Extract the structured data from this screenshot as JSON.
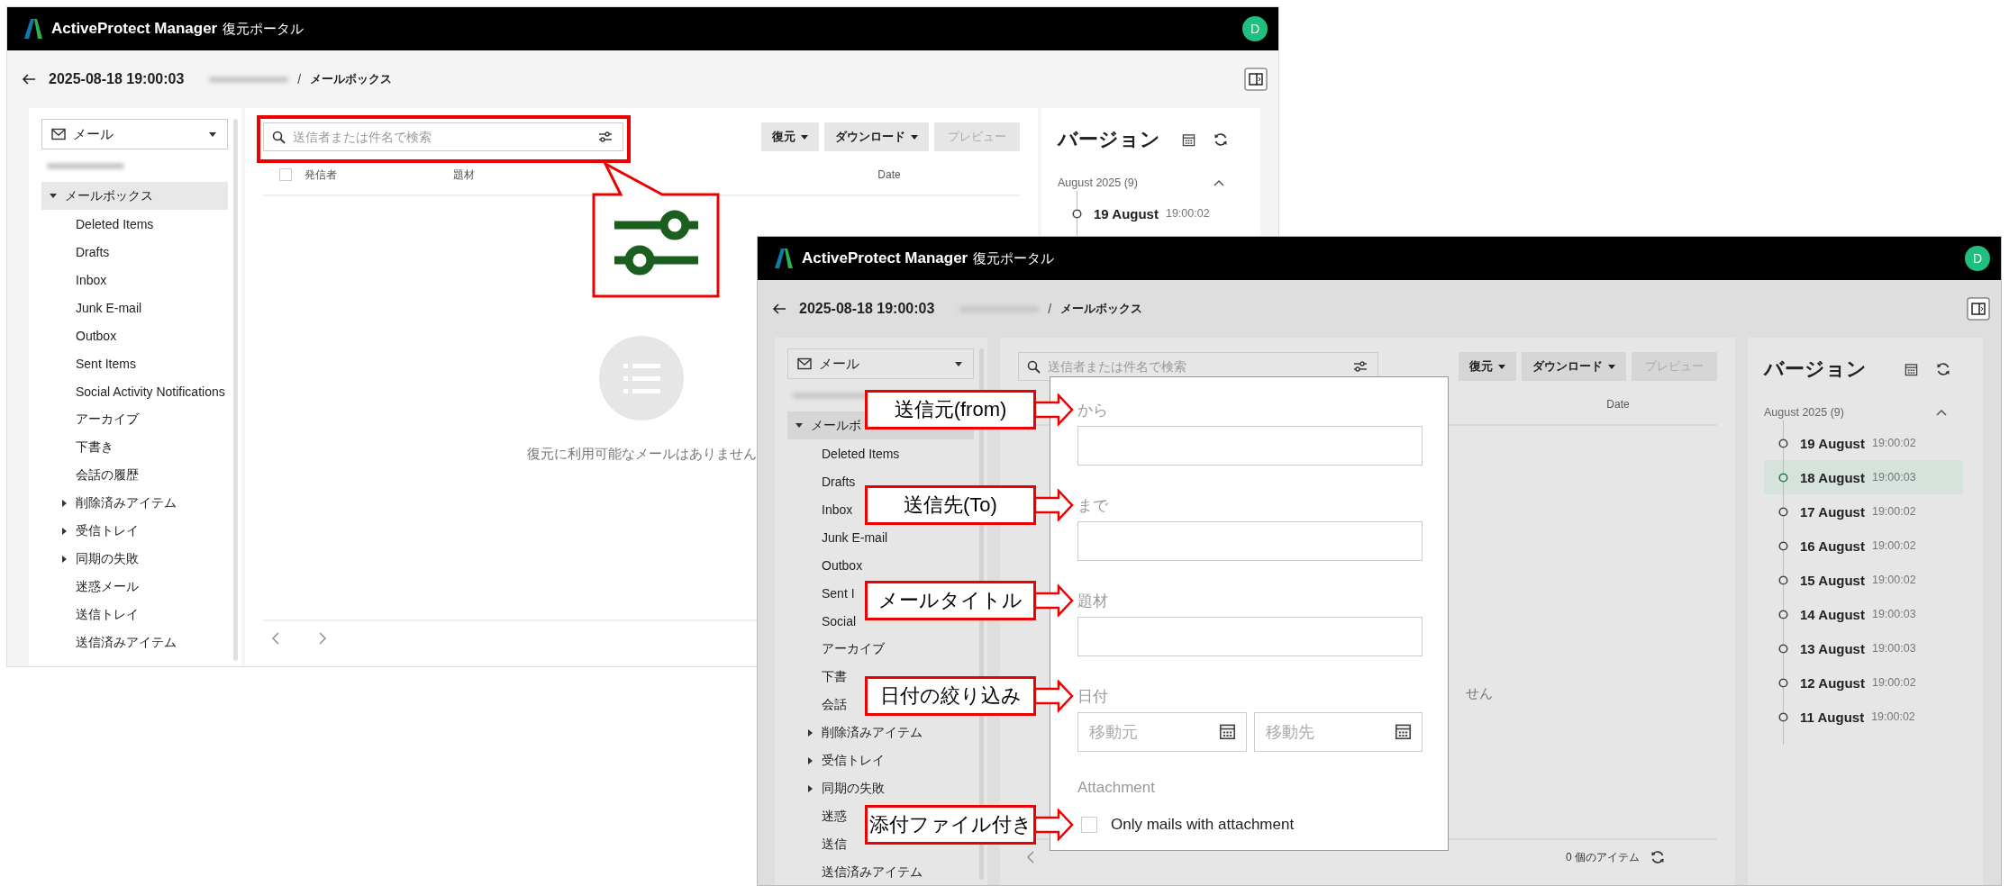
{
  "windows": [
    {
      "dimmed": false,
      "header": {
        "brand": "ActiveProtect Manager",
        "subtitle": "復元ポータル",
        "avatar": "D"
      },
      "breadcrumb": {
        "date": "2025-08-18 19:00:03",
        "separator": "/",
        "section": "メールボックス"
      },
      "sidebar": {
        "dropdown": "メール",
        "tree": [
          {
            "label": "メールボックス",
            "kind": "group",
            "expanded": true,
            "selected": true,
            "children": [
              {
                "label": "Deleted Items",
                "kind": "leaf",
                "selected": false
              },
              {
                "label": "Drafts",
                "kind": "leaf",
                "selected": false
              },
              {
                "label": "Inbox",
                "kind": "leaf",
                "selected": false
              },
              {
                "label": "Junk E-mail",
                "kind": "leaf",
                "selected": false
              },
              {
                "label": "Outbox",
                "kind": "leaf",
                "selected": false
              },
              {
                "label": "Sent Items",
                "kind": "leaf",
                "selected": false
              },
              {
                "label": "Social Activity Notifications",
                "kind": "leaf",
                "selected": false
              },
              {
                "label": "アーカイブ",
                "kind": "leaf",
                "selected": false
              },
              {
                "label": "下書き",
                "kind": "leaf",
                "selected": false
              },
              {
                "label": "会話の履歴",
                "kind": "leaf",
                "selected": false
              },
              {
                "label": "削除済みアイテム",
                "kind": "group",
                "expanded": false,
                "selected": false
              },
              {
                "label": "受信トレイ",
                "kind": "group",
                "expanded": false,
                "selected": false
              },
              {
                "label": "同期の失敗",
                "kind": "group",
                "expanded": false,
                "selected": false
              },
              {
                "label": "迷惑メール",
                "kind": "leaf",
                "selected": false
              },
              {
                "label": "送信トレイ",
                "kind": "leaf",
                "selected": false
              },
              {
                "label": "送信済みアイテム",
                "kind": "leaf",
                "selected": false
              }
            ]
          }
        ]
      },
      "search": {
        "placeholder": "送信者または件名で検索",
        "highlighted": true
      },
      "buttons": [
        {
          "label": "復元",
          "menu": true,
          "disabled": false
        },
        {
          "label": "ダウンロード",
          "menu": true,
          "disabled": false
        },
        {
          "label": "プレビュー",
          "menu": false,
          "disabled": true
        }
      ],
      "select_all": {
        "checked": false
      },
      "columns": [
        {
          "kind": "sender",
          "label": "発信者"
        },
        {
          "kind": "subject",
          "label": "題材"
        },
        {
          "kind": "date",
          "label": "Date"
        }
      ],
      "empty_state": {
        "kind": "full",
        "message": "復元に利用可能なメールはありません"
      },
      "pager": {
        "prev": true,
        "next": true
      },
      "versions": {
        "title": "バージョン",
        "group": {
          "label": "August 2025 (9)",
          "expanded": true
        },
        "items": [
          {
            "day": "19 August",
            "time": "19:00:02",
            "selected": false
          }
        ]
      }
    },
    {
      "dimmed": true,
      "header": {
        "brand": "ActiveProtect Manager",
        "subtitle": "復元ポータル",
        "avatar": "D"
      },
      "breadcrumb": {
        "date": "2025-08-18 19:00:03",
        "separator": "/",
        "section": "メールボックス"
      },
      "sidebar": {
        "dropdown": "メール",
        "tree": [
          {
            "label": "メールボ",
            "kind": "group",
            "expanded": true,
            "selected": true,
            "children": [
              {
                "label": "Deleted Items",
                "kind": "leaf",
                "selected": false
              },
              {
                "label": "Drafts",
                "kind": "leaf",
                "selected": false
              },
              {
                "label": "Inbox",
                "kind": "leaf",
                "selected": false
              },
              {
                "label": "Junk E-mail",
                "kind": "leaf",
                "selected": false
              },
              {
                "label": "Outbox",
                "kind": "leaf",
                "selected": false
              },
              {
                "label": "Sent I",
                "kind": "leaf",
                "selected": false
              },
              {
                "label": "Social",
                "kind": "leaf",
                "selected": false
              },
              {
                "label": "アーカイブ",
                "kind": "leaf",
                "selected": false
              },
              {
                "label": "下書",
                "kind": "leaf",
                "selected": false
              },
              {
                "label": "会話",
                "kind": "leaf",
                "selected": false
              },
              {
                "label": "削除済みアイテム",
                "kind": "group",
                "expanded": false,
                "selected": false
              },
              {
                "label": "受信トレイ",
                "kind": "group",
                "expanded": false,
                "selected": false
              },
              {
                "label": "同期の失敗",
                "kind": "group",
                "expanded": false,
                "selected": false
              },
              {
                "label": "迷惑",
                "kind": "leaf",
                "selected": false
              },
              {
                "label": "送信",
                "kind": "leaf",
                "selected": false
              },
              {
                "label": "送信済みアイテム",
                "kind": "leaf",
                "selected": false
              }
            ]
          }
        ]
      },
      "search": {
        "placeholder": "送信者または件名で検索"
      },
      "buttons": [
        {
          "label": "復元",
          "menu": true,
          "disabled": false
        },
        {
          "label": "ダウンロード",
          "menu": true,
          "disabled": false
        },
        {
          "label": "プレビュー",
          "menu": false,
          "disabled": true
        }
      ],
      "columns": [
        {
          "kind": "date",
          "label": "Date"
        }
      ],
      "empty_state": {
        "kind": "tail",
        "message": "せん"
      },
      "pager": {
        "prev": true,
        "item_count": "0 個のアイテム"
      },
      "versions": {
        "title": "バージョン",
        "group": {
          "label": "August 2025 (9)",
          "expanded": true
        },
        "items": [
          {
            "day": "19 August",
            "time": "19:00:02",
            "selected": false
          },
          {
            "day": "18 August",
            "time": "19:00:03",
            "selected": true
          },
          {
            "day": "17 August",
            "time": "19:00:02",
            "selected": false
          },
          {
            "day": "16 August",
            "time": "19:00:02",
            "selected": false
          },
          {
            "day": "15 August",
            "time": "19:00:02",
            "selected": false
          },
          {
            "day": "14 August",
            "time": "19:00:03",
            "selected": false
          },
          {
            "day": "13 August",
            "time": "19:00:03",
            "selected": false
          },
          {
            "day": "12 August",
            "time": "19:00:02",
            "selected": false
          },
          {
            "day": "11 August",
            "time": "19:00:02",
            "selected": false
          }
        ]
      },
      "filter_popup": {
        "fields": [
          {
            "kind": "text",
            "label": "から",
            "callout": "送信元(from)"
          },
          {
            "kind": "text",
            "label": "まで",
            "callout": "送信先(To)"
          },
          {
            "kind": "text",
            "label": "題材",
            "callout": "メールタイトル"
          },
          {
            "kind": "date_range",
            "label": "日付",
            "from_placeholder": "移動元",
            "to_placeholder": "移動先",
            "callout": "日付の絞り込み"
          },
          {
            "kind": "checkbox",
            "label": "Attachment",
            "option": "Only mails with attachment",
            "checked": false,
            "callout": "添付ファイル付き"
          }
        ]
      }
    }
  ]
}
